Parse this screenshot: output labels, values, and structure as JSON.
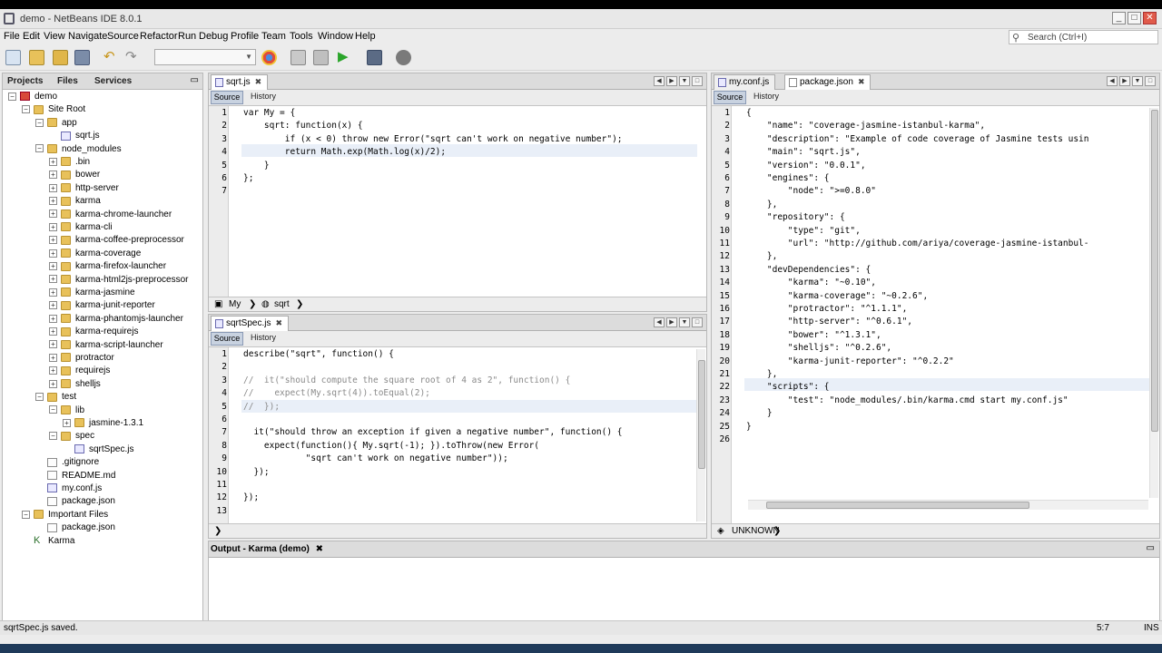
{
  "window": {
    "title": "demo - NetBeans IDE 8.0.1"
  },
  "menubar": [
    "File",
    "Edit",
    "View",
    "Navigate",
    "Source",
    "Refactor",
    "Run",
    "Debug",
    "Profile",
    "Team",
    "Tools",
    "Window",
    "Help"
  ],
  "search": {
    "placeholder": "Search (Ctrl+I)"
  },
  "projects_panel": {
    "tabs": [
      "Projects",
      "Files",
      "Services"
    ],
    "tree": [
      {
        "label": "demo",
        "level": 0,
        "type": "proj",
        "exp": "-"
      },
      {
        "label": "Site Root",
        "level": 1,
        "type": "folder",
        "exp": "-"
      },
      {
        "label": "app",
        "level": 2,
        "type": "folder",
        "exp": "-"
      },
      {
        "label": "sqrt.js",
        "level": 3,
        "type": "js",
        "exp": ""
      },
      {
        "label": "node_modules",
        "level": 2,
        "type": "folder",
        "exp": "-"
      },
      {
        "label": ".bin",
        "level": 3,
        "type": "folder",
        "exp": "+"
      },
      {
        "label": "bower",
        "level": 3,
        "type": "folder",
        "exp": "+"
      },
      {
        "label": "http-server",
        "level": 3,
        "type": "folder",
        "exp": "+"
      },
      {
        "label": "karma",
        "level": 3,
        "type": "folder",
        "exp": "+"
      },
      {
        "label": "karma-chrome-launcher",
        "level": 3,
        "type": "folder",
        "exp": "+"
      },
      {
        "label": "karma-cli",
        "level": 3,
        "type": "folder",
        "exp": "+"
      },
      {
        "label": "karma-coffee-preprocessor",
        "level": 3,
        "type": "folder",
        "exp": "+"
      },
      {
        "label": "karma-coverage",
        "level": 3,
        "type": "folder",
        "exp": "+"
      },
      {
        "label": "karma-firefox-launcher",
        "level": 3,
        "type": "folder",
        "exp": "+"
      },
      {
        "label": "karma-html2js-preprocessor",
        "level": 3,
        "type": "folder",
        "exp": "+"
      },
      {
        "label": "karma-jasmine",
        "level": 3,
        "type": "folder",
        "exp": "+"
      },
      {
        "label": "karma-junit-reporter",
        "level": 3,
        "type": "folder",
        "exp": "+"
      },
      {
        "label": "karma-phantomjs-launcher",
        "level": 3,
        "type": "folder",
        "exp": "+"
      },
      {
        "label": "karma-requirejs",
        "level": 3,
        "type": "folder",
        "exp": "+"
      },
      {
        "label": "karma-script-launcher",
        "level": 3,
        "type": "folder",
        "exp": "+"
      },
      {
        "label": "protractor",
        "level": 3,
        "type": "folder",
        "exp": "+"
      },
      {
        "label": "requirejs",
        "level": 3,
        "type": "folder",
        "exp": "+"
      },
      {
        "label": "shelljs",
        "level": 3,
        "type": "folder",
        "exp": "+"
      },
      {
        "label": "test",
        "level": 2,
        "type": "folder",
        "exp": "-"
      },
      {
        "label": "lib",
        "level": 3,
        "type": "folder",
        "exp": "-"
      },
      {
        "label": "jasmine-1.3.1",
        "level": 4,
        "type": "folder",
        "exp": "+"
      },
      {
        "label": "spec",
        "level": 3,
        "type": "folder",
        "exp": "-"
      },
      {
        "label": "sqrtSpec.js",
        "level": 4,
        "type": "js",
        "exp": ""
      },
      {
        "label": ".gitignore",
        "level": 2,
        "type": "file",
        "exp": ""
      },
      {
        "label": "README.md",
        "level": 2,
        "type": "file",
        "exp": ""
      },
      {
        "label": "my.conf.js",
        "level": 2,
        "type": "js",
        "exp": ""
      },
      {
        "label": "package.json",
        "level": 2,
        "type": "file",
        "exp": ""
      },
      {
        "label": "Important Files",
        "level": 1,
        "type": "folder",
        "exp": "-"
      },
      {
        "label": "package.json",
        "level": 2,
        "type": "file",
        "exp": ""
      },
      {
        "label": "Karma",
        "level": 1,
        "type": "karma",
        "exp": ""
      }
    ]
  },
  "editor_sqrt": {
    "tab": "sqrt.js",
    "source_label": "Source",
    "history_label": "History",
    "breadcrumb": [
      "My",
      "sqrt"
    ],
    "lines": [
      "var My = {",
      "    sqrt: function(x) {",
      "        if (x < 0) throw new Error(\"sqrt can't work on negative number\");",
      "        return Math.exp(Math.log(x)/2);",
      "    }",
      "};",
      ""
    ]
  },
  "editor_spec": {
    "tab": "sqrtSpec.js",
    "source_label": "Source",
    "history_label": "History",
    "lines": [
      "describe(\"sqrt\", function() {",
      "",
      "//  it(\"should compute the square root of 4 as 2\", function() {",
      "//    expect(My.sqrt(4)).toEqual(2);",
      "//  });",
      "",
      "  it(\"should throw an exception if given a negative number\", function() {",
      "    expect(function(){ My.sqrt(-1); }).toThrow(new Error(",
      "            \"sqrt can't work on negative number\"));",
      "  });",
      "",
      "});",
      ""
    ]
  },
  "editor_pkg": {
    "tabs": [
      "my.conf.js",
      "package.json"
    ],
    "source_label": "Source",
    "history_label": "History",
    "breadcrumb": "UNKNOWN",
    "lines": [
      "{",
      "    \"name\": \"coverage-jasmine-istanbul-karma\",",
      "    \"description\": \"Example of code coverage of Jasmine tests usin",
      "    \"main\": \"sqrt.js\",",
      "    \"version\": \"0.0.1\",",
      "    \"engines\": {",
      "        \"node\": \">=0.8.0\"",
      "    },",
      "    \"repository\": {",
      "        \"type\": \"git\",",
      "        \"url\": \"http://github.com/ariya/coverage-jasmine-istanbul-",
      "    },",
      "    \"devDependencies\": {",
      "        \"karma\": \"~0.10\",",
      "        \"karma-coverage\": \"~0.2.6\",",
      "        \"protractor\": \"^1.1.1\",",
      "        \"http-server\": \"^0.6.1\",",
      "        \"bower\": \"^1.3.1\",",
      "        \"shelljs\": \"^0.2.6\",",
      "        \"karma-junit-reporter\": \"^0.2.2\"",
      "    },",
      "    \"scripts\": {",
      "        \"test\": \"node_modules/.bin/karma.cmd start my.conf.js\"",
      "    }",
      "}",
      ""
    ]
  },
  "output": {
    "title": "Output - Karma (demo)"
  },
  "status": {
    "message": "sqrtSpec.js saved.",
    "position": "5:7",
    "mode": "INS"
  }
}
